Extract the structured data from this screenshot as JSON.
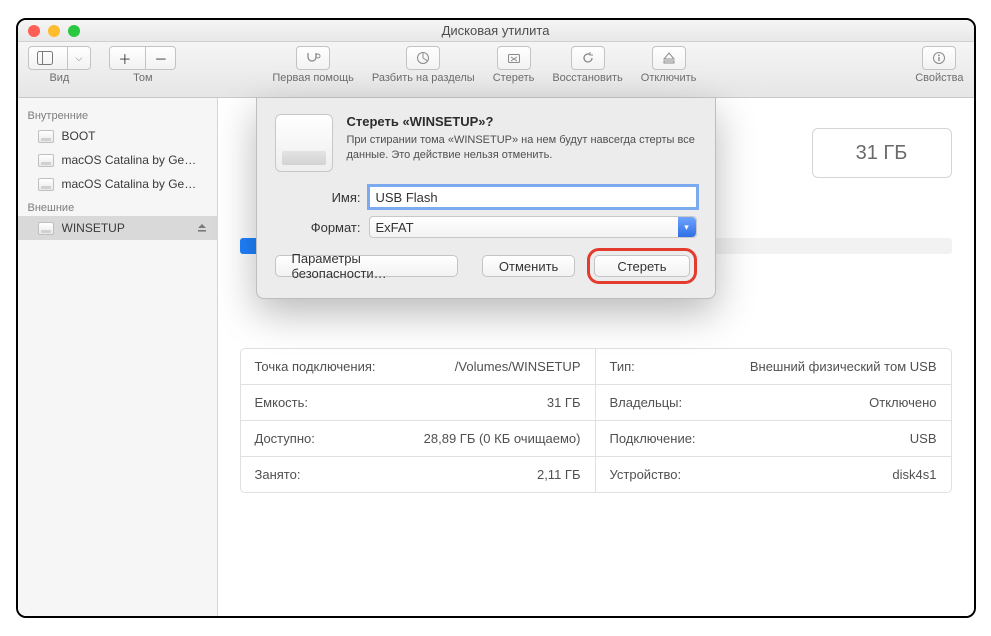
{
  "window": {
    "title": "Дисковая утилита"
  },
  "toolbar": {
    "view": "Вид",
    "volume": "Том",
    "firstaid": "Первая помощь",
    "partition": "Разбить на разделы",
    "erase": "Стереть",
    "restore": "Восстановить",
    "unmount": "Отключить",
    "info": "Свойства"
  },
  "sidebar": {
    "internal_header": "Внутренние",
    "external_header": "Внешние",
    "items_internal": [
      {
        "label": "BOOT"
      },
      {
        "label": "macOS Catalina by Ge…"
      },
      {
        "label": "macOS Catalina by Ge…"
      }
    ],
    "items_external": [
      {
        "label": "WINSETUP"
      }
    ]
  },
  "capacity_badge": "31 ГБ",
  "dialog": {
    "title": "Стереть «WINSETUP»?",
    "message": "При стирании тома «WINSETUP» на нем будут навсегда стерты все данные. Это действие нельзя отменить.",
    "name_label": "Имя:",
    "name_value": "USB Flash",
    "format_label": "Формат:",
    "format_value": "ExFAT",
    "security_btn": "Параметры безопасности…",
    "cancel_btn": "Отменить",
    "erase_btn": "Стереть"
  },
  "details": [
    {
      "k": "Точка подключения:",
      "v": "/Volumes/WINSETUP"
    },
    {
      "k": "Тип:",
      "v": "Внешний физический том USB"
    },
    {
      "k": "Емкость:",
      "v": "31 ГБ"
    },
    {
      "k": "Владельцы:",
      "v": "Отключено"
    },
    {
      "k": "Доступно:",
      "v": "28,89 ГБ (0 КБ очищаемо)"
    },
    {
      "k": "Подключение:",
      "v": "USB"
    },
    {
      "k": "Занято:",
      "v": "2,11 ГБ"
    },
    {
      "k": "Устройство:",
      "v": "disk4s1"
    }
  ]
}
